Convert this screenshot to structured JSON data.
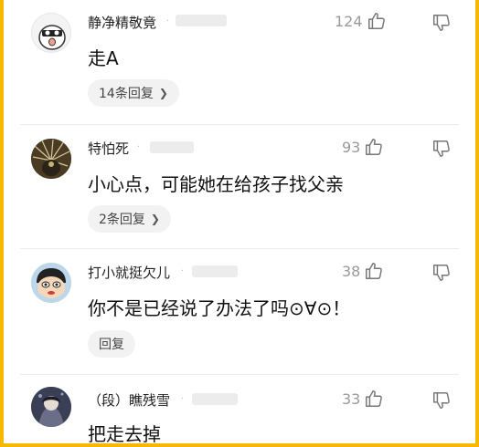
{
  "colors": {
    "frame": "#F6B800",
    "text": "#111111",
    "muted": "#999999",
    "pill_bg": "#F2F2F2"
  },
  "comments": [
    {
      "username": "静净精敬竟",
      "likes": "124",
      "text": "走A",
      "action": "14条回复",
      "has_chevron": true
    },
    {
      "username": "特怕死",
      "likes": "93",
      "text": "小心点，可能她在给孩子找父亲",
      "action": "2条回复",
      "has_chevron": true
    },
    {
      "username": "打小就挺欠儿",
      "likes": "38",
      "text": "你不是已经说了办法了吗⊙∀⊙！",
      "action": "回复",
      "has_chevron": false
    },
    {
      "username": "（段）瞧残雪",
      "likes": "33",
      "text": "把走去掉"
    }
  ],
  "icons": {
    "like": "thumbs-up-icon",
    "dislike": "thumbs-down-icon",
    "reply_chevron": "chevron-right-icon"
  },
  "separator": "·"
}
